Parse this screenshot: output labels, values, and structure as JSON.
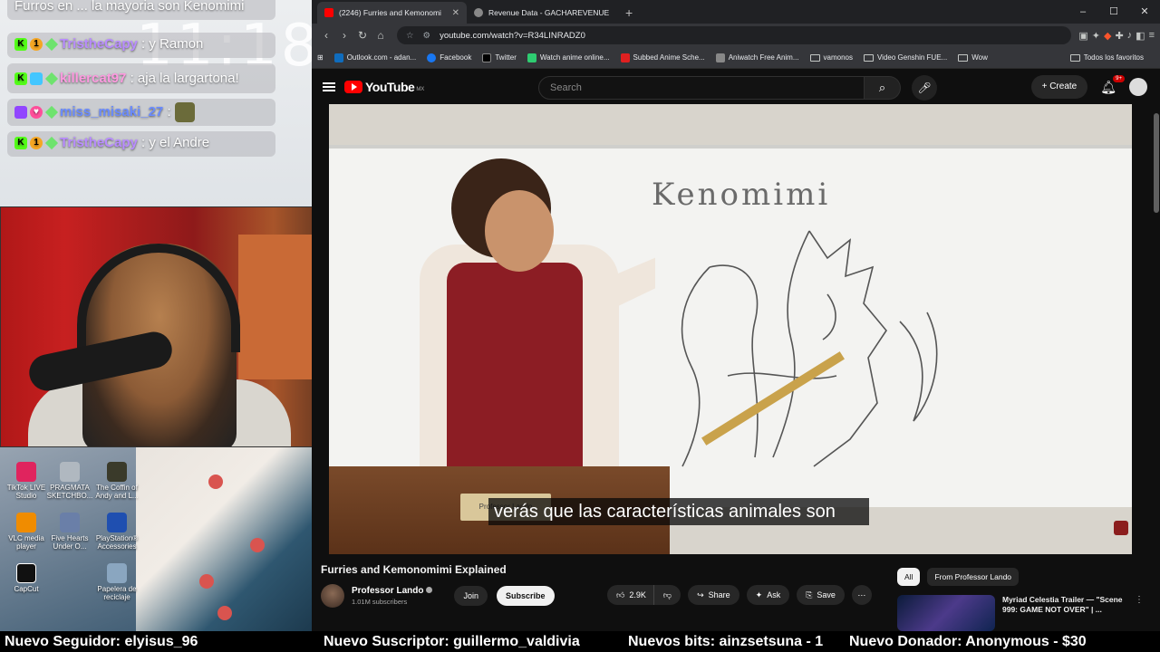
{
  "overlay": {
    "clock": "11:18",
    "chat": [
      {
        "user": "",
        "text": "Furros en ... la mayoria son Kenomimi"
      },
      {
        "user": "TristheCapy",
        "text": ": y Ramon",
        "user_color": "#b98cff"
      },
      {
        "user": "killercat97",
        "text": ": aja la largartona!",
        "user_color": "#ff9ae0"
      },
      {
        "user": "miss_misaki_27",
        "text": ":",
        "user_color": "#6a8bff"
      },
      {
        "user": "TristheCapy",
        "text": ": y el Andre",
        "user_color": "#b98cff"
      }
    ],
    "desktop_icons": [
      {
        "label": "TikTok LIVE Studio",
        "icon": "tiktok-icon",
        "color": "#e0245e"
      },
      {
        "label": "PRAGMATA SKETCHBO...",
        "icon": "game-icon",
        "color": "#b0b8c0"
      },
      {
        "label": "The Coffin of Andy and L...",
        "icon": "game-icon",
        "color": "#3a3a2a"
      },
      {
        "label": "VLC media player",
        "icon": "vlc-icon",
        "color": "#f08c00"
      },
      {
        "label": "Five Hearts Under O...",
        "icon": "game-icon",
        "color": "#6a7fa8"
      },
      {
        "label": "PlayStation® Accessories",
        "icon": "playstation-icon",
        "color": "#1f4fb0"
      },
      {
        "label": "CapCut",
        "icon": "capcut-icon",
        "color": "#111111"
      },
      {
        "label": "Papelera de reciclaje",
        "icon": "recycle-bin-icon",
        "color": "#8aa6c0"
      }
    ]
  },
  "browser": {
    "tabs": [
      {
        "title": "(2246) Furries and Kemonomi",
        "icon": "youtube-icon",
        "active": true
      },
      {
        "title": "Revenue Data - GACHAREVENUE",
        "icon": "site-icon",
        "active": false
      }
    ],
    "new_tab": "+",
    "window_controls": [
      "–",
      "☐",
      "✕"
    ],
    "url": "youtube.com/watch?v=R34LINRADZ0",
    "bookmarks": [
      {
        "label": "Outlook.com - adan...",
        "icon": "outlook-icon",
        "color": "#0f6cbd"
      },
      {
        "label": "Facebook",
        "icon": "facebook-icon",
        "color": "#1877f2"
      },
      {
        "label": "Twitter",
        "icon": "x-icon",
        "color": "#000000"
      },
      {
        "label": "Watch anime online...",
        "icon": "anime-icon",
        "color": "#2ecc71"
      },
      {
        "label": "Subbed Anime Sche...",
        "icon": "anime-icon",
        "color": "#e02020"
      },
      {
        "label": "Aniwatch Free Anim...",
        "icon": "anime-icon",
        "color": "#888888"
      },
      {
        "label": "vamonos",
        "icon": "folder-icon",
        "color": ""
      },
      {
        "label": "Video Genshin FUE...",
        "icon": "folder-icon",
        "color": ""
      },
      {
        "label": "Wow",
        "icon": "folder-icon",
        "color": ""
      }
    ],
    "all_bookmarks": "Todos los favoritos"
  },
  "youtube": {
    "logo": "YouTube",
    "region": "MX",
    "search_placeholder": "Search",
    "create_label": "Create",
    "notifications": "9+",
    "video": {
      "whiteboard_word": "Kenomimi",
      "nameplate": "Professor Lando",
      "subtitle": "verás que las características animales son"
    },
    "title": "Furries and Kemonomimi Explained",
    "channel": {
      "name": "Professor Lando",
      "subscribers": "1.01M subscribers"
    },
    "join_label": "Join",
    "subscribe_label": "Subscribe",
    "likes": "2.9K",
    "share_label": "Share",
    "ask_label": "Ask",
    "save_label": "Save",
    "chips": [
      "All",
      "From Professor Lando"
    ],
    "recommended": {
      "title": "Myriad Celestia Trailer — \"Scene 999: GAME NOT OVER\" | ..."
    }
  },
  "ticker": [
    "Nuevo Seguidor: elyisus_96",
    "Nuevo Suscriptor: guillermo_valdivia",
    "Nuevos bits: ainzsetsuna - 1",
    "Nuevo Donador: Anonymous - $30"
  ]
}
